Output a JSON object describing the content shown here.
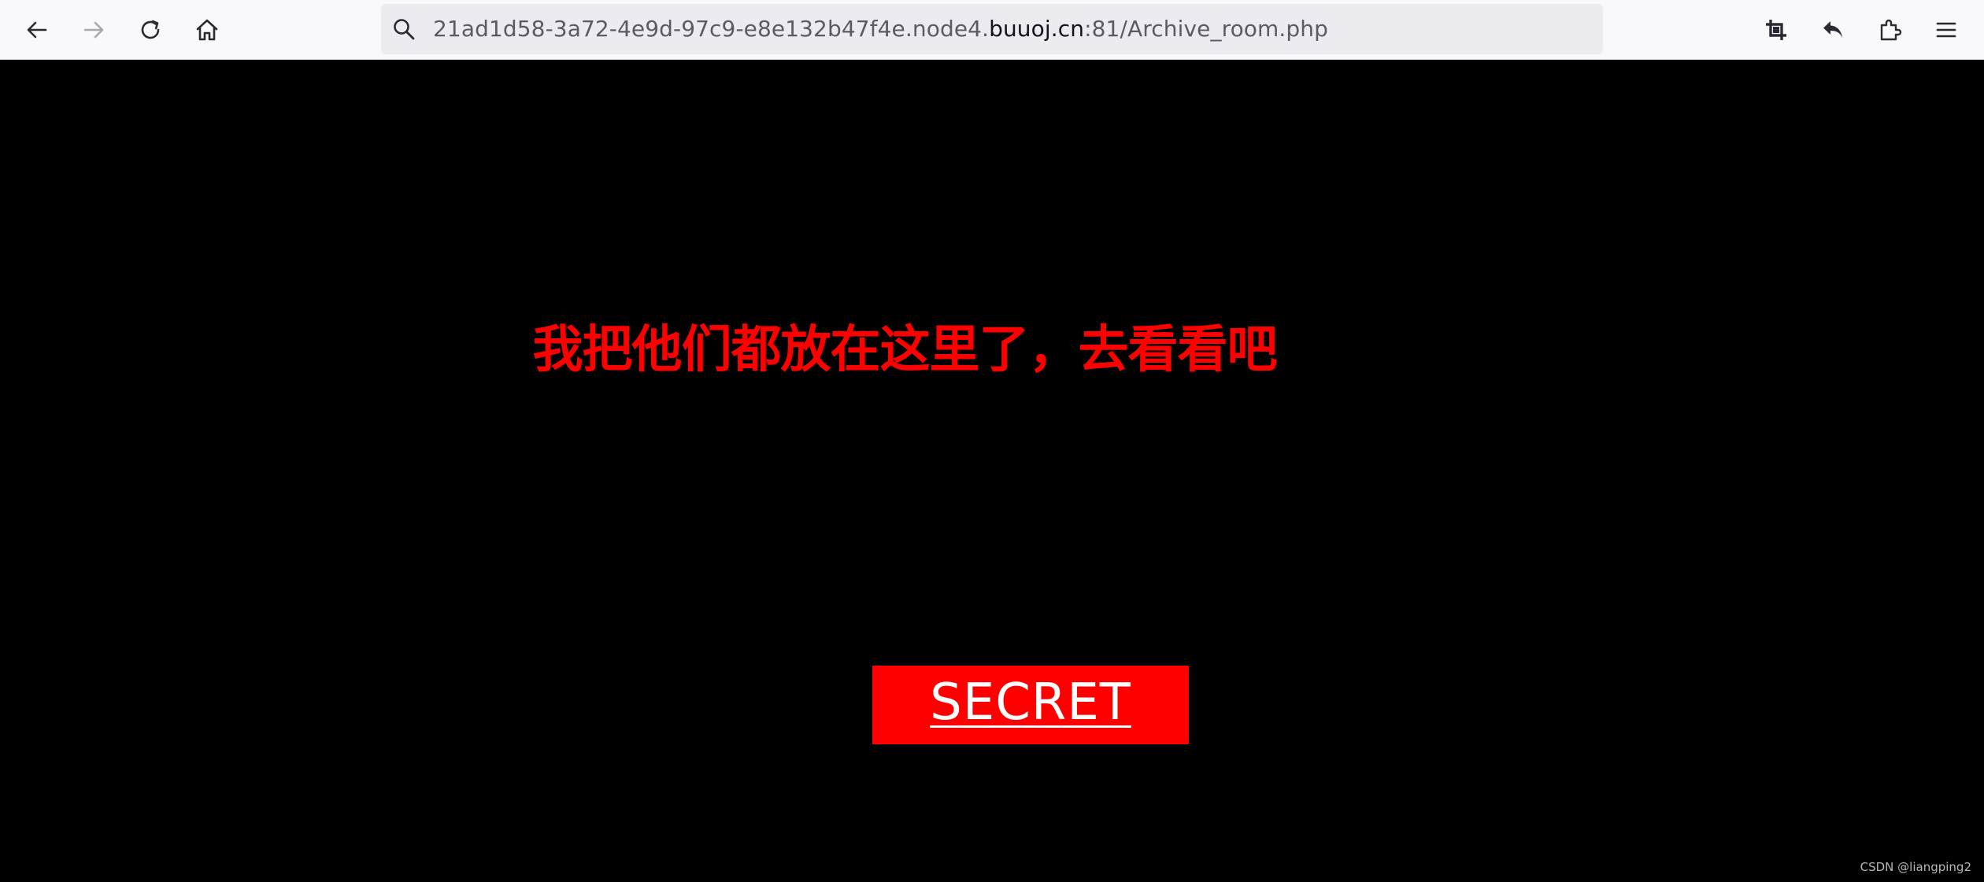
{
  "browser": {
    "url": {
      "prefix": "21ad1d58-3a72-4e9d-97c9-e8e132b47f4e.node4.",
      "domain": "buuoj.cn",
      "suffix": ":81/Archive_room.php"
    },
    "icons": {
      "back": "arrow-left-icon",
      "forward": "arrow-right-icon",
      "reload": "reload-icon",
      "home": "home-icon",
      "search": "search-icon",
      "screenshot": "crop-icon",
      "undo": "reply-icon",
      "extensions": "puzzle-icon",
      "menu": "hamburger-menu-icon"
    }
  },
  "page": {
    "headline": "我把他们都放在这里了，去看看吧",
    "button_label": "SECRET",
    "accent_color": "#ff0000",
    "background_color": "#000000"
  },
  "watermark": "CSDN @liangping2"
}
